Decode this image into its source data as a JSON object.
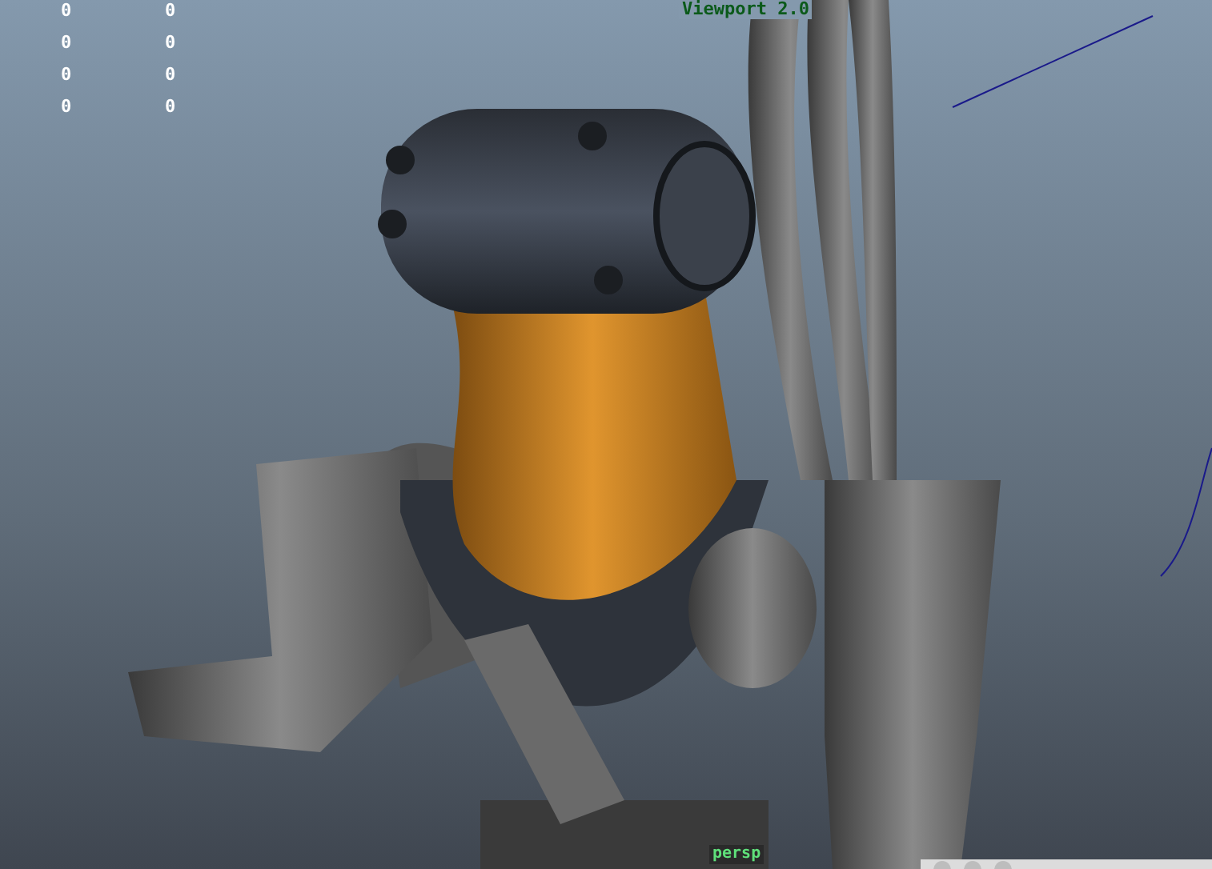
{
  "viewport": {
    "renderer_label": "Viewport 2.0",
    "camera_label": "persp",
    "hud_stats": [
      {
        "value_1": "0",
        "value_2": "0"
      },
      {
        "value_1": "0",
        "value_2": "0"
      },
      {
        "value_1": "0",
        "value_2": "0"
      },
      {
        "value_1": "0",
        "value_2": "0"
      }
    ]
  }
}
